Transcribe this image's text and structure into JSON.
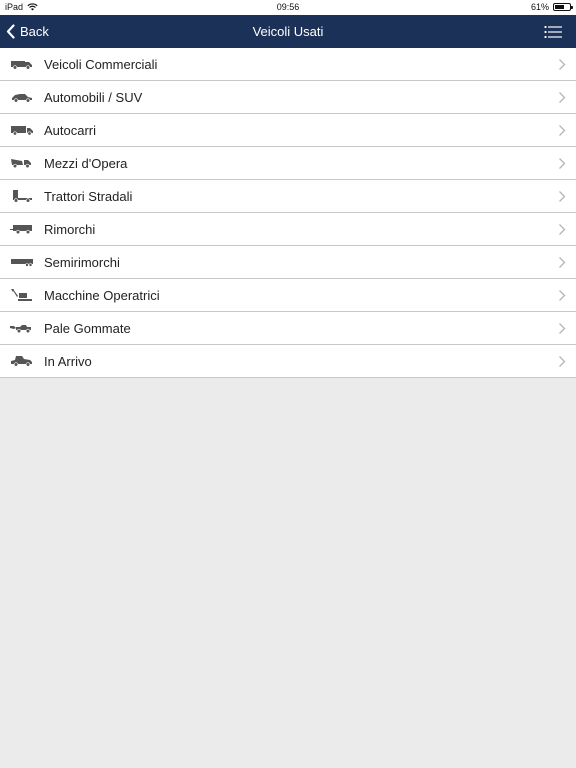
{
  "status_bar": {
    "device": "iPad",
    "time": "09:56",
    "battery": "61%",
    "battery_level": 0.61
  },
  "navbar": {
    "back_label": "Back",
    "title": "Veicoli Usati",
    "bg_color": "#1b3157"
  },
  "list": {
    "items": [
      {
        "label": "Veicoli Commerciali",
        "icon": "van-icon"
      },
      {
        "label": "Automobili / SUV",
        "icon": "car-icon"
      },
      {
        "label": "Autocarri",
        "icon": "truck-icon"
      },
      {
        "label": "Mezzi d'Opera",
        "icon": "dump-truck-icon"
      },
      {
        "label": "Trattori Stradali",
        "icon": "tractor-unit-icon"
      },
      {
        "label": "Rimorchi",
        "icon": "trailer-icon"
      },
      {
        "label": "Semirimorchi",
        "icon": "semitrailer-icon"
      },
      {
        "label": "Macchine Operatrici",
        "icon": "excavator-icon"
      },
      {
        "label": "Pale Gommate",
        "icon": "wheel-loader-icon"
      },
      {
        "label": "In Arrivo",
        "icon": "tow-truck-icon"
      }
    ]
  }
}
